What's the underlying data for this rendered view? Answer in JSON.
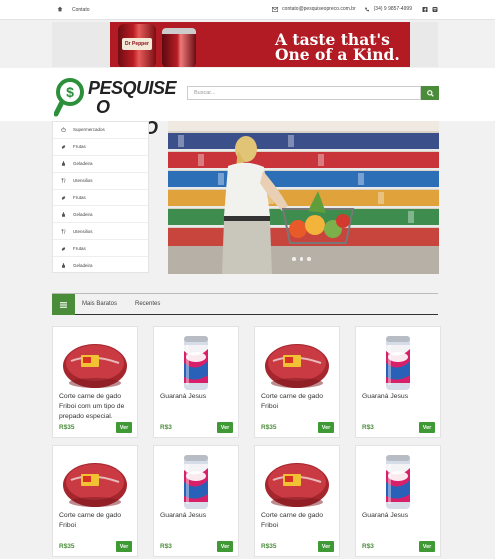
{
  "topbar": {
    "contato": "Contato",
    "email": "contato@pesquiseopreco.com.br",
    "phone": "(34) 9 9857-4999"
  },
  "banner": {
    "brand": "Dr Pepper",
    "line1": "A taste that's",
    "line2": "One of a Kind."
  },
  "logo": {
    "line1": "PESQUISE",
    "line2": "O PREÇO"
  },
  "search": {
    "placeholder": "Buscar..."
  },
  "sidebar": {
    "items": [
      {
        "label": "Supermercados",
        "icon": "basket-icon"
      },
      {
        "label": "Frutas",
        "icon": "fruit-icon"
      },
      {
        "label": "Geladeira",
        "icon": "bottle-icon"
      },
      {
        "label": "Utensilios",
        "icon": "cutlery-icon"
      },
      {
        "label": "Frutas",
        "icon": "fruit-icon"
      },
      {
        "label": "Geladeira",
        "icon": "bottle-icon"
      },
      {
        "label": "Utensilios",
        "icon": "cutlery-icon"
      },
      {
        "label": "Frutas",
        "icon": "fruit-icon"
      },
      {
        "label": "Geladeira",
        "icon": "bottle-icon"
      }
    ]
  },
  "tabs": {
    "items": [
      "Mais Baratos",
      "Recentes"
    ]
  },
  "products": [
    {
      "name": "Corte carne de gado Friboi com um tipo de prepado especial.",
      "price": "R$35",
      "button": "Ver",
      "image": "meat"
    },
    {
      "name": "Guaraná Jesus",
      "price": "R$3",
      "button": "Ver",
      "image": "can"
    },
    {
      "name": "Corte carne de gado Friboi",
      "price": "R$35",
      "button": "Ver",
      "image": "meat"
    },
    {
      "name": "Guaraná Jesus",
      "price": "R$3",
      "button": "Ver",
      "image": "can"
    },
    {
      "name": "Corte carne de gado Friboi",
      "price": "R$35",
      "button": "Ver",
      "image": "meat"
    },
    {
      "name": "Guaraná Jesus",
      "price": "R$3",
      "button": "Ver",
      "image": "can"
    },
    {
      "name": "Corte carne de gado Friboi",
      "price": "R$35",
      "button": "Ver",
      "image": "meat"
    },
    {
      "name": "Guaraná Jesus",
      "price": "R$3",
      "button": "Ver",
      "image": "can"
    }
  ],
  "colors": {
    "accent": "#4b8c3a",
    "button": "#3f9a35",
    "banner_red": "#b31b24"
  }
}
